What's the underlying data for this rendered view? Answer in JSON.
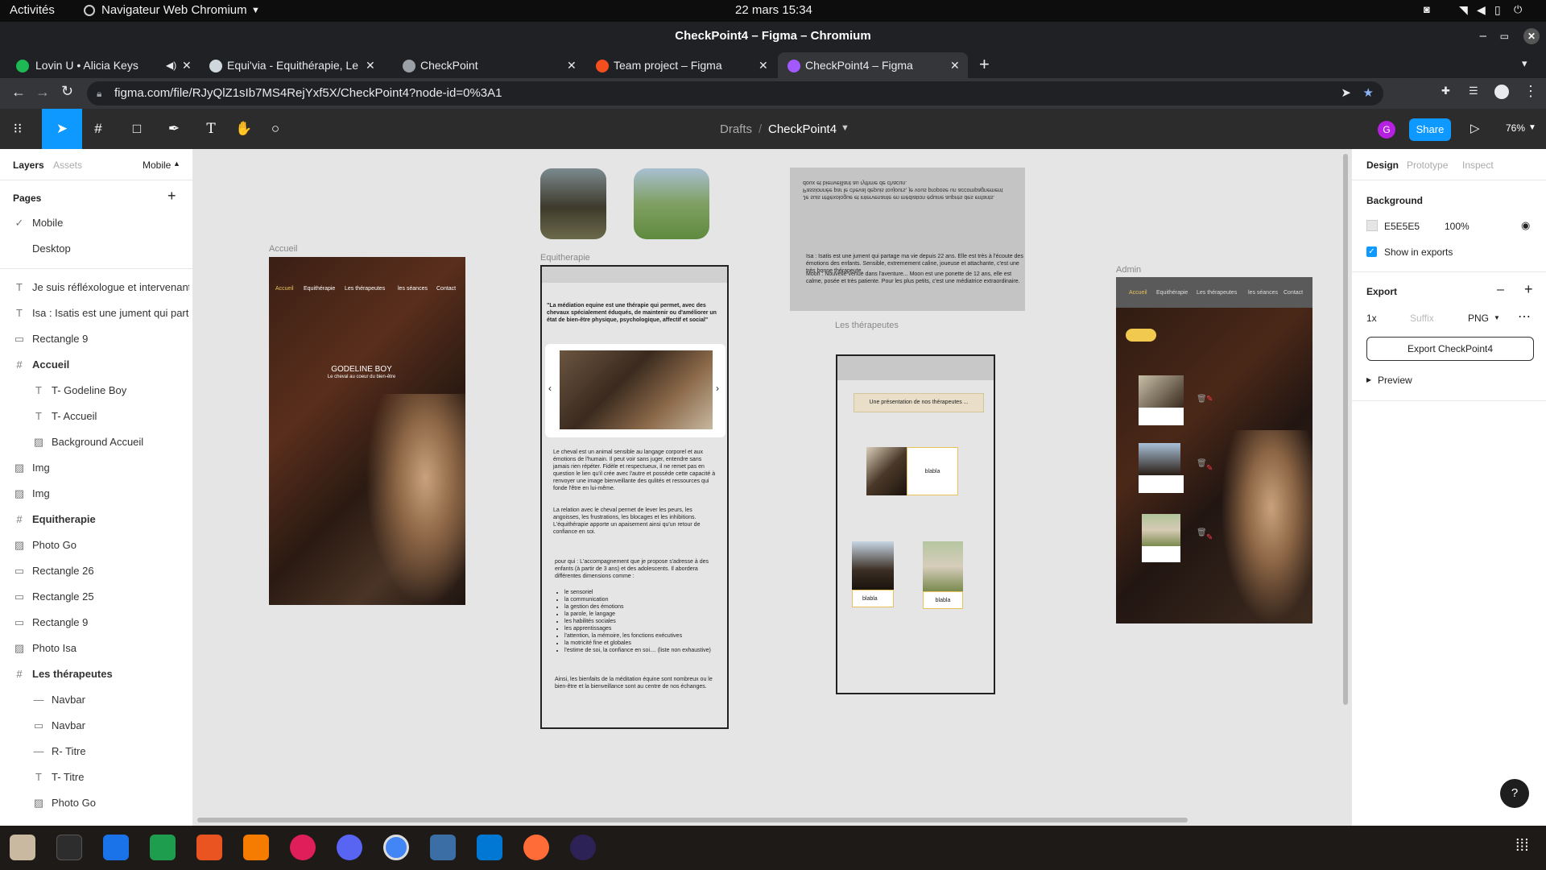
{
  "system": {
    "activities": "Activités",
    "app_menu": "Navigateur Web Chromium",
    "clock": "22 mars  15:34"
  },
  "window": {
    "title": "CheckPoint4 – Figma – Chromium"
  },
  "tabs": [
    {
      "label": "Lovin U • Alicia Keys",
      "color": "#1db954"
    },
    {
      "label": "Equi'via - Equithérapie, Le",
      "color": "#cfd8dc"
    },
    {
      "label": "CheckPoint",
      "color": "#9aa0a6"
    },
    {
      "label": "Team project – Figma",
      "color": "#f24e1e"
    },
    {
      "label": "CheckPoint4 – Figma",
      "color": "#a259ff"
    }
  ],
  "address": {
    "url": "figma.com/file/RJyQlZ1sIb7MS4RejYxf5X/CheckPoint4?node-id=0%3A1"
  },
  "figma": {
    "breadcrumb_drafts": "Drafts",
    "breadcrumb_sep": "/",
    "file_name": "CheckPoint4",
    "share_label": "Share",
    "avatar_initial": "G",
    "zoom": "76%"
  },
  "left_panel": {
    "tab_layers": "Layers",
    "tab_assets": "Assets",
    "page_selector": "Mobile",
    "pages_title": "Pages",
    "pages": [
      "Mobile",
      "Desktop"
    ],
    "layers": [
      {
        "icon": "text",
        "label": "Je suis réfléxologue et intervenant...",
        "indent": 0,
        "bold": false
      },
      {
        "icon": "text",
        "label": "Isa : Isatis est une jument qui part...",
        "indent": 0,
        "bold": false
      },
      {
        "icon": "rect",
        "label": "Rectangle 9",
        "indent": 0,
        "bold": false
      },
      {
        "icon": "frame",
        "label": "Accueil",
        "indent": 0,
        "bold": true
      },
      {
        "icon": "text",
        "label": "T- Godeline Boy",
        "indent": 1,
        "bold": false
      },
      {
        "icon": "text",
        "label": "T- Accueil",
        "indent": 1,
        "bold": false
      },
      {
        "icon": "image",
        "label": "Background Accueil",
        "indent": 1,
        "bold": false
      },
      {
        "icon": "image",
        "label": "Img",
        "indent": 0,
        "bold": false
      },
      {
        "icon": "image",
        "label": "Img",
        "indent": 0,
        "bold": false
      },
      {
        "icon": "frame",
        "label": "Equitherapie",
        "indent": 0,
        "bold": true
      },
      {
        "icon": "image",
        "label": "Photo Go",
        "indent": 0,
        "bold": false
      },
      {
        "icon": "rect",
        "label": "Rectangle 26",
        "indent": 0,
        "bold": false
      },
      {
        "icon": "rect",
        "label": "Rectangle 25",
        "indent": 0,
        "bold": false
      },
      {
        "icon": "rect",
        "label": "Rectangle 9",
        "indent": 0,
        "bold": false
      },
      {
        "icon": "image",
        "label": "Photo Isa",
        "indent": 0,
        "bold": false
      },
      {
        "icon": "frame",
        "label": "Les thérapeutes",
        "indent": 0,
        "bold": true
      },
      {
        "icon": "line",
        "label": "Navbar",
        "indent": 1,
        "bold": false
      },
      {
        "icon": "rect",
        "label": "Navbar",
        "indent": 1,
        "bold": false
      },
      {
        "icon": "line",
        "label": "R- Titre",
        "indent": 1,
        "bold": false
      },
      {
        "icon": "text",
        "label": "T- Titre",
        "indent": 1,
        "bold": false
      },
      {
        "icon": "image",
        "label": "Photo Go",
        "indent": 1,
        "bold": false
      }
    ]
  },
  "right_panel": {
    "tab_design": "Design",
    "tab_prototype": "Prototype",
    "tab_inspect": "Inspect",
    "background_title": "Background",
    "bg_hex": "E5E5E5",
    "bg_opacity": "100%",
    "show_exports": "Show in exports",
    "export_title": "Export",
    "scale": "1x",
    "suffix_placeholder": "Suffix",
    "format": "PNG",
    "export_button": "Export CheckPoint4",
    "preview": "Preview",
    "help": "?"
  },
  "canvas": {
    "accueil": {
      "label": "Accueil",
      "nav": [
        "Accueil",
        "Equithérapie",
        "Les thérapeutes",
        "les séances",
        "Contact"
      ],
      "title": "GODELINE  BOY",
      "subtitle": "Le cheval au coeur du bien-être"
    },
    "equitherapie": {
      "label": "Equitherapie",
      "quote": "\"La médiation equine est une thérapie qui permet, avec des chevaux spécialement éduqués, de maintenir ou d'améliorer un état de bien-être physique, psychologique, affectif et social\"",
      "p1": "Le cheval est un animal sensible au langage corporel et aux émotions de l'humain. Il peut voir sans juger, entendre sans jamais rien répéter. Fidèle et respectueux, il ne remet pas en question le lien qu'il crée avec l'autre et possède cette capacité à renvoyer une image bienveillante des qulités et ressources qui fonde l'être en lui-même.",
      "p2": "La relation avec le cheval permet de lever les peurs, les angoisses, les frustrations, les blocages et les inhibitions. L'équithérapie apporte un apaisement ainsi qu'un retour de confiance en soi.",
      "p3_intro": "pour qui : L'accompagnement que je propose s'adresse à des enfants (à partir de 3 ans) et des adolescents. Il abordera différentes dimensions comme :",
      "list": [
        "le sensoriel",
        "la communication",
        "la gestion des émotions",
        "la parole, le langage",
        "les habilités sociales",
        "les apprentissages",
        "l'attention, la mémoire, les fonctions exécutives",
        "la motricité fine et globales",
        "l'estime de soi, la confiance en soi.... (liste non exhaustive)"
      ],
      "p4": "Ainsi, les bienfaits de la méditation équine sont nombreux ou le bien-être et la bienveillance sont au centre de nos échanges."
    },
    "isa_moon": {
      "mirrored": "Je suis réfléxologue et intervenante en médiation équine auprès des enfants. Passionnée par le cheval depuis toujours, je vous propose un accompagnement doux et bienveillant au rythme de chacun.",
      "isa": "Isa : Isatis est une jument qui  partage ma vie depuis 22 ans. Elle est très à l'écoute des émotions des enfants. Sensible, extremement caline, joueuse et attachante, c'est une très bonne thérapeute.",
      "moon": "Moon : Nouvelle venue dans l'aventure... Moon est une ponette de 12 ans, elle est calme, posée et très patiente. Pour les plus petits, c'est une médiatrice extraordinaire."
    },
    "therapeutes": {
      "label": "Les thérapeutes",
      "banner": "Une présentation de nos thérapeutes ...",
      "card1": "blabla",
      "card2": "blabla",
      "card3": "blabla"
    },
    "admin": {
      "label": "Admin",
      "nav": [
        "Accueil",
        "Equithérapie",
        "Les thérapeutes",
        "les séances",
        "Contact"
      ]
    }
  }
}
